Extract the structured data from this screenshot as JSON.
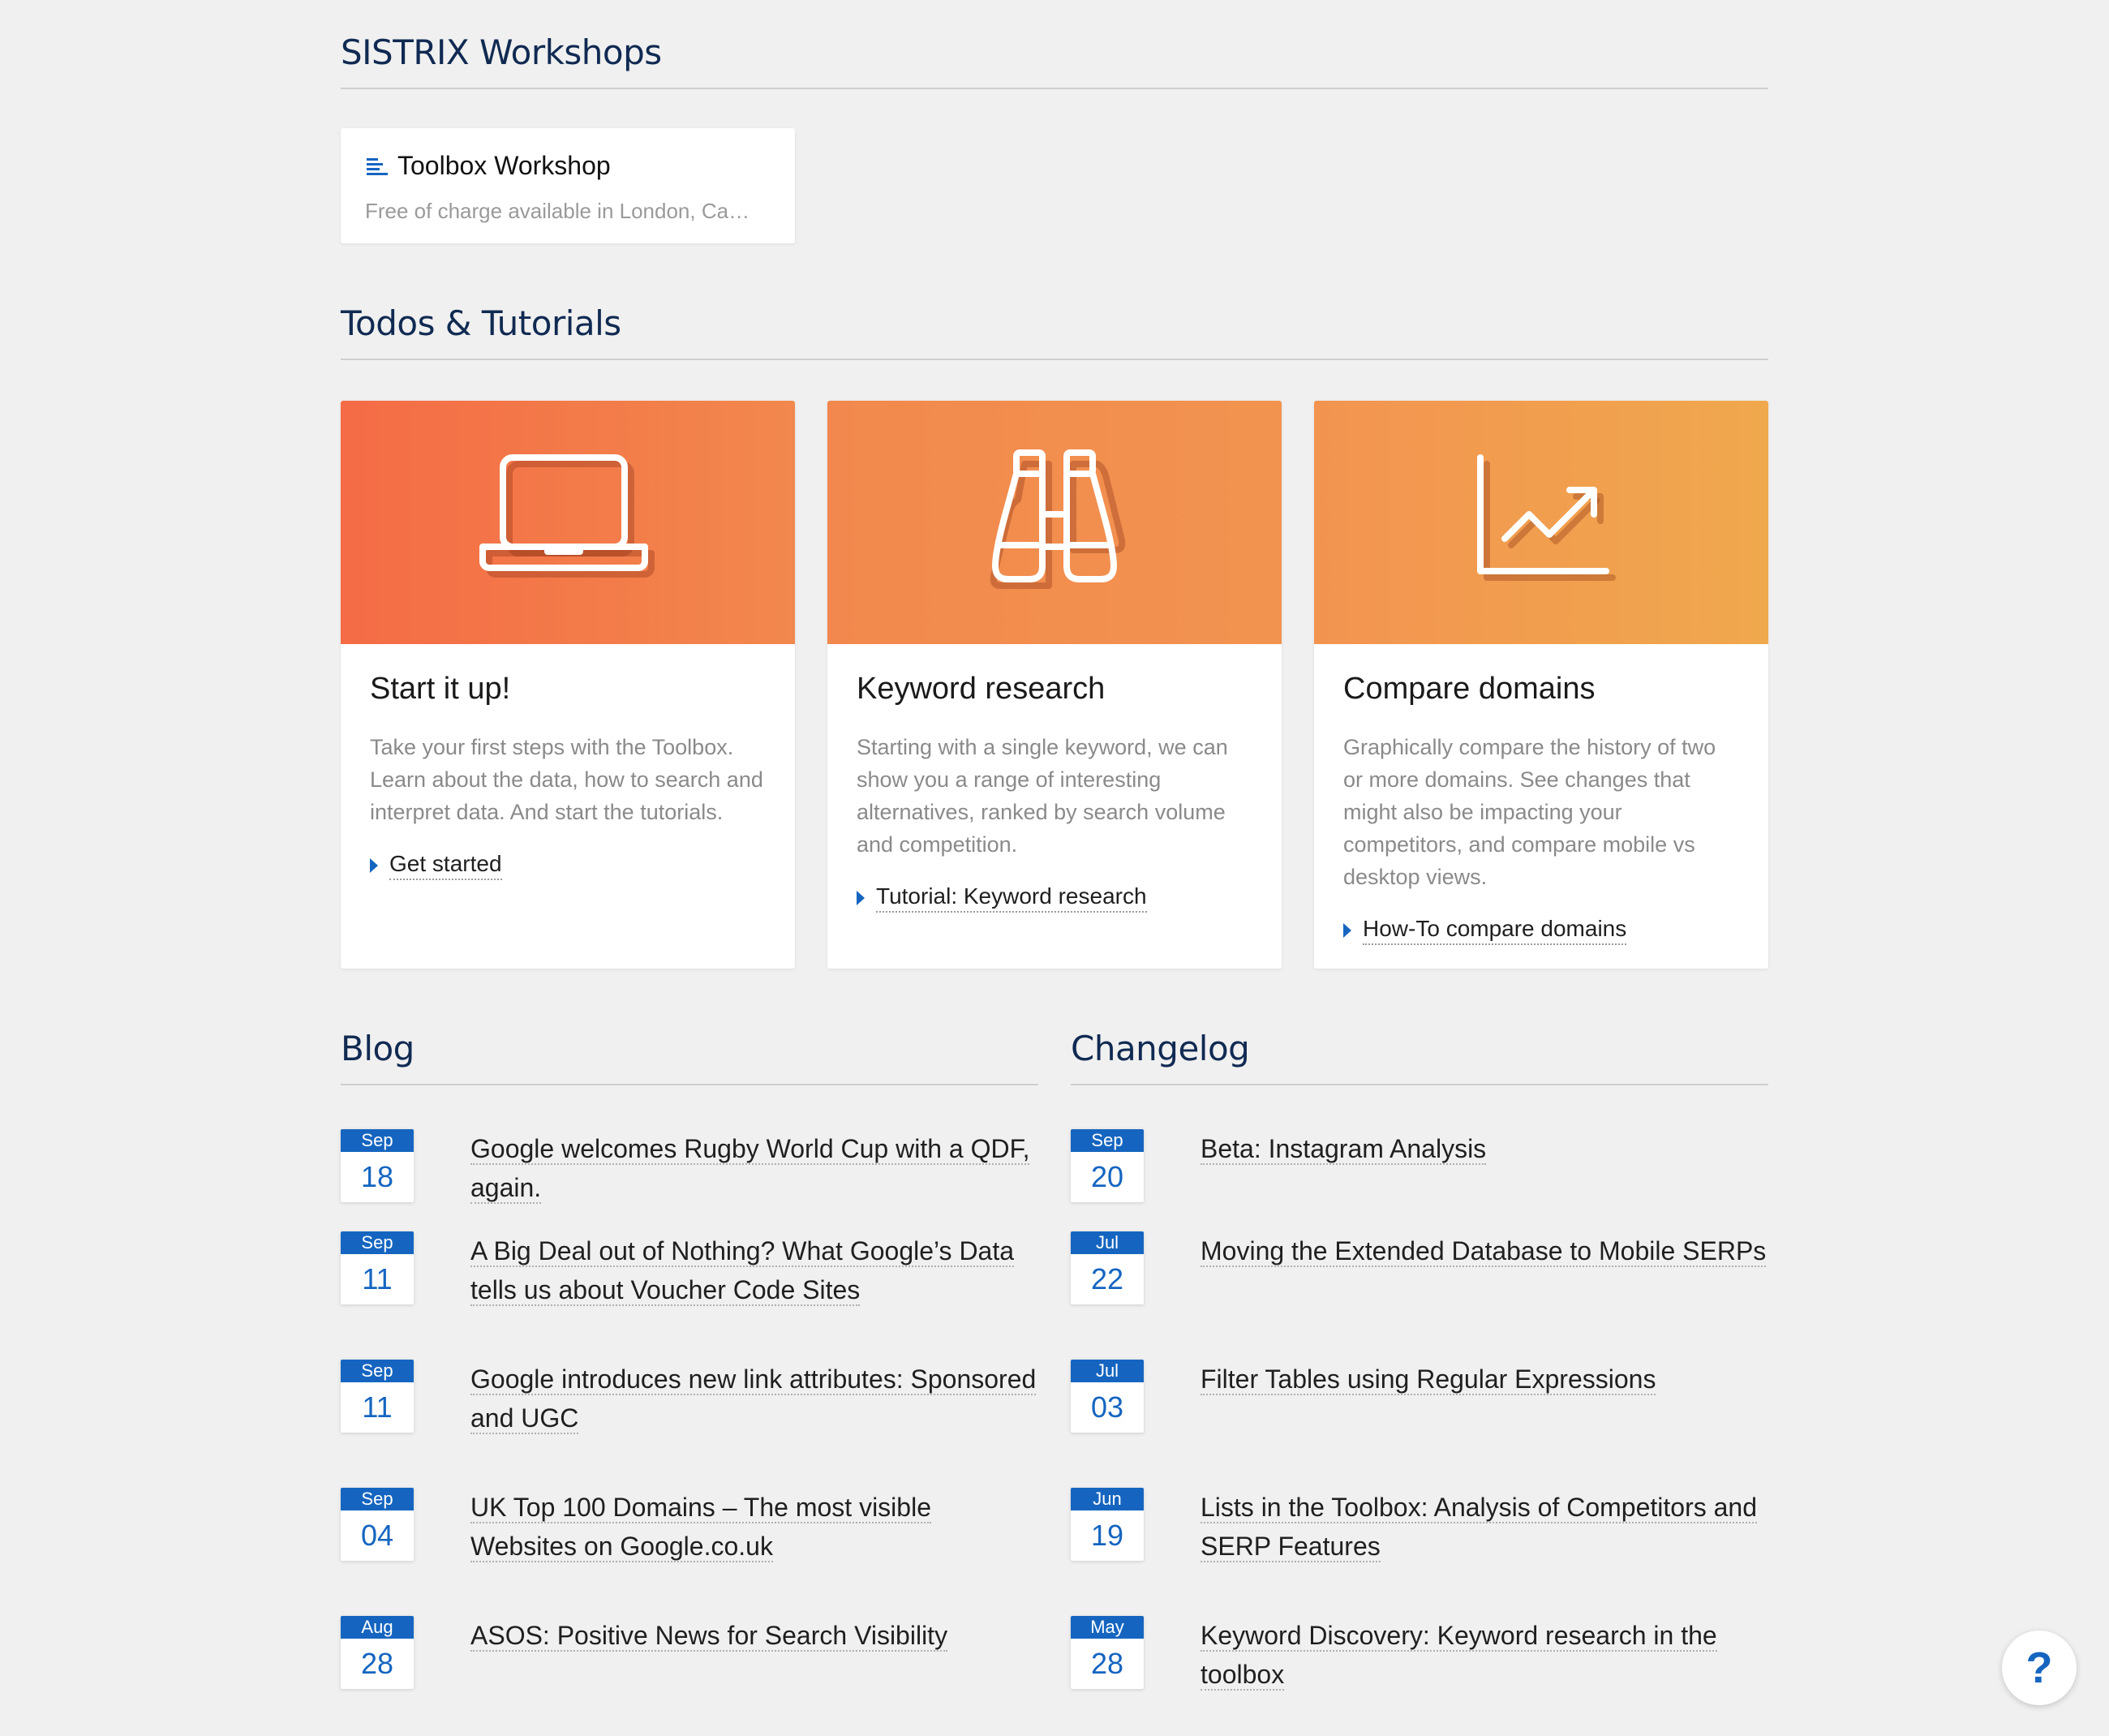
{
  "workshops": {
    "title": "SISTRIX Workshops",
    "card": {
      "name": "Toolbox Workshop",
      "description": "Free of charge available in London, Ca…"
    }
  },
  "todos": {
    "title": "Todos & Tutorials",
    "cards": [
      {
        "icon": "laptop-icon",
        "title": "Start it up!",
        "description": "Take your first steps with the Toolbox. Learn about the data, how to search and interpret data. And start the tutorials.",
        "link": "Get started",
        "gradient_from": "#f46b45",
        "gradient_to": "#f2884d"
      },
      {
        "icon": "binoculars-icon",
        "title": "Keyword research",
        "description": "Starting with a single keyword, we can show you a range of interesting alternatives, ranked by search volume and competition.",
        "link": "Tutorial: Keyword research",
        "gradient_from": "#f2884d",
        "gradient_to": "#f29450"
      },
      {
        "icon": "chart-growth-icon",
        "title": "Compare domains",
        "description": "Graphically compare the history of two or more domains. See changes that might also be impacting your competitors, and compare mobile vs desktop views.",
        "link": "How-To compare domains",
        "gradient_from": "#f29450",
        "gradient_to": "#f0a84d"
      }
    ]
  },
  "blog": {
    "title": "Blog",
    "items": [
      {
        "month": "Sep",
        "day": "18",
        "lines": [
          "Google welcomes Rugby World Cup with a QDF,",
          "again."
        ]
      },
      {
        "month": "Sep",
        "day": "11",
        "lines": [
          "A Big Deal out of Nothing? What Google’s Data",
          "tells us about Voucher Code Sites"
        ]
      },
      {
        "month": "Sep",
        "day": "11",
        "lines": [
          "Google introduces new link attributes: Sponsored",
          "and UGC"
        ]
      },
      {
        "month": "Sep",
        "day": "04",
        "lines": [
          "UK Top 100 Domains – The most visible",
          "Websites on Google.co.uk"
        ]
      },
      {
        "month": "Aug",
        "day": "28",
        "lines": [
          "ASOS: Positive News for Search Visibility"
        ]
      }
    ]
  },
  "changelog": {
    "title": "Changelog",
    "items": [
      {
        "month": "Sep",
        "day": "20",
        "lines": [
          "Beta: Instagram Analysis"
        ]
      },
      {
        "month": "Jul",
        "day": "22",
        "lines": [
          "Moving the Extended Database to Mobile SERPs"
        ]
      },
      {
        "month": "Jul",
        "day": "03",
        "lines": [
          "Filter Tables using Regular Expressions"
        ]
      },
      {
        "month": "Jun",
        "day": "19",
        "lines": [
          "Lists in the Toolbox: Analysis of Competitors and",
          "SERP Features"
        ]
      },
      {
        "month": "May",
        "day": "28",
        "lines": [
          "Keyword Discovery: Keyword research in the",
          "toolbox"
        ]
      }
    ]
  },
  "help": {
    "label": "?"
  },
  "colors": {
    "accent": "#1565c0",
    "heading": "#102a52"
  }
}
